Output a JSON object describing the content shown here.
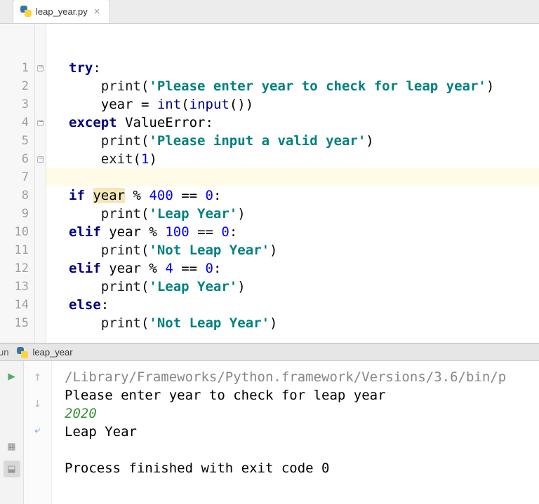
{
  "tab": {
    "filename": "leap_year.py"
  },
  "editor": {
    "lines": [
      {
        "n": 1,
        "fold": true
      },
      {
        "n": 2,
        "fold": false
      },
      {
        "n": 3,
        "fold": false
      },
      {
        "n": 4,
        "fold": true
      },
      {
        "n": 5,
        "fold": false
      },
      {
        "n": 6,
        "fold": true
      },
      {
        "n": 7,
        "fold": false
      },
      {
        "n": 8,
        "fold": false
      },
      {
        "n": 9,
        "fold": false
      },
      {
        "n": 10,
        "fold": false
      },
      {
        "n": 11,
        "fold": false
      },
      {
        "n": 12,
        "fold": false
      },
      {
        "n": 13,
        "fold": false
      },
      {
        "n": 14,
        "fold": false
      },
      {
        "n": 15,
        "fold": false
      }
    ],
    "code": {
      "kw_try": "try",
      "colon": ":",
      "fn_print": "print",
      "lp": "(",
      "rp": ")",
      "str_prompt": "'Please enter year to check for leap year'",
      "id_year": "year",
      "eq": " = ",
      "bi_int": "int",
      "bi_input": "input",
      "kw_except": "except",
      "cls_valueerror": " ValueError",
      "str_invalid": "'Please input a valid year'",
      "fn_exit": "exit",
      "num_1": "1",
      "kw_if": "if",
      "sp": " ",
      "op_mod": " % ",
      "num_400": "400",
      "op_eqeq": " == ",
      "num_0": "0",
      "str_leap": "'Leap Year'",
      "kw_elif": "elif",
      "num_100": "100",
      "str_notleap": "'Not Leap Year'",
      "num_4": "4",
      "kw_else": "else",
      "indent1": "    ",
      "indent2": "        "
    },
    "highlight_line": 7,
    "highlight_word": "year"
  },
  "run": {
    "header_label": "un",
    "config_name": "leap_year",
    "console": {
      "path": "/Library/Frameworks/Python.framework/Versions/3.6/bin/p",
      "prompt": "Please enter year to check for leap year",
      "input": "2020",
      "output": "Leap Year",
      "exit": "Process finished with exit code 0"
    }
  }
}
